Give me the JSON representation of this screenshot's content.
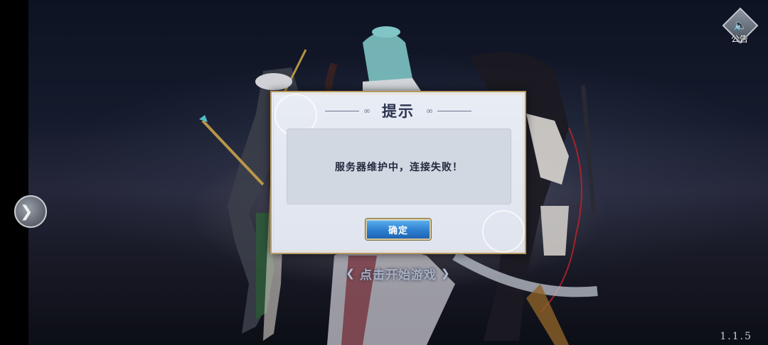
{
  "dialog": {
    "title": "提示",
    "message": "服务器维护中，连接失败！",
    "ok_label": "确定"
  },
  "start_prompt": {
    "label": "点击开始游戏",
    "left_glyph": "❮",
    "right_glyph": "❯"
  },
  "announcement": {
    "label": "公告",
    "icon": "speaker-icon",
    "glyph": "🔈"
  },
  "side_arrow": {
    "glyph": "❯",
    "icon": "double-chevron-right-icon"
  },
  "version": "1.1.5",
  "colors": {
    "dialog_border": "#b89a63",
    "dialog_bg": "#e4e8f0",
    "button_blue": "#2d7fd0",
    "title_text": "#2b3350"
  }
}
